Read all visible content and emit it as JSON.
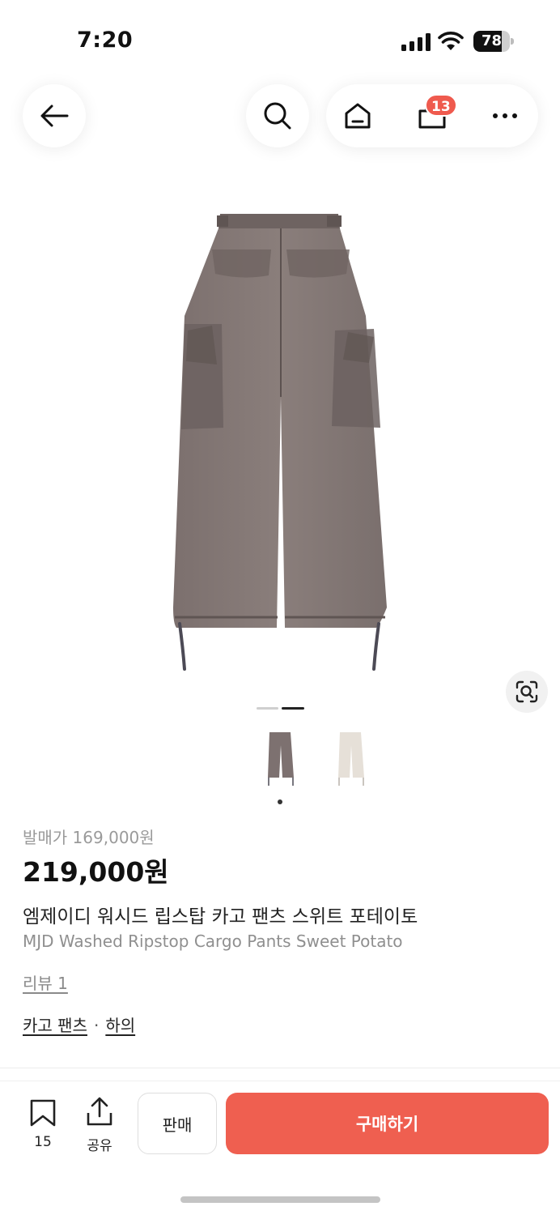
{
  "status_bar": {
    "time": "7:20",
    "battery_level": "78"
  },
  "nav": {
    "back_icon": "arrow-left-icon",
    "search_icon": "search-icon",
    "home_icon": "home-icon",
    "cart_icon": "cart-icon",
    "cart_count": "13",
    "more_icon": "more-dots-icon"
  },
  "gallery": {
    "image_count": 2,
    "active_index": 1,
    "thumbnails": [
      {
        "color": "#7d7170"
      },
      {
        "color": "#e6e0d8"
      }
    ],
    "lens_icon": "image-search-icon"
  },
  "product": {
    "release_price": "발매가 169,000원",
    "price": "219,000원",
    "title_ko": "엠제이디 워시드 립스탑 카고 팬츠 스위트 포테이토",
    "title_en": "MJD Washed Ripstop Cargo Pants Sweet Potato",
    "review": "리뷰 1",
    "category_1": "카고 팬츠",
    "category_sep": "·",
    "category_2": "하의"
  },
  "actions": {
    "bookmark_icon": "bookmark-icon",
    "bookmark_count": "15",
    "share_icon": "share-icon",
    "share_label": "공유",
    "sell_label": "판매",
    "buy_label": "구매하기"
  },
  "colors": {
    "accent": "#ef5f50",
    "badge": "#ef5a4e"
  }
}
